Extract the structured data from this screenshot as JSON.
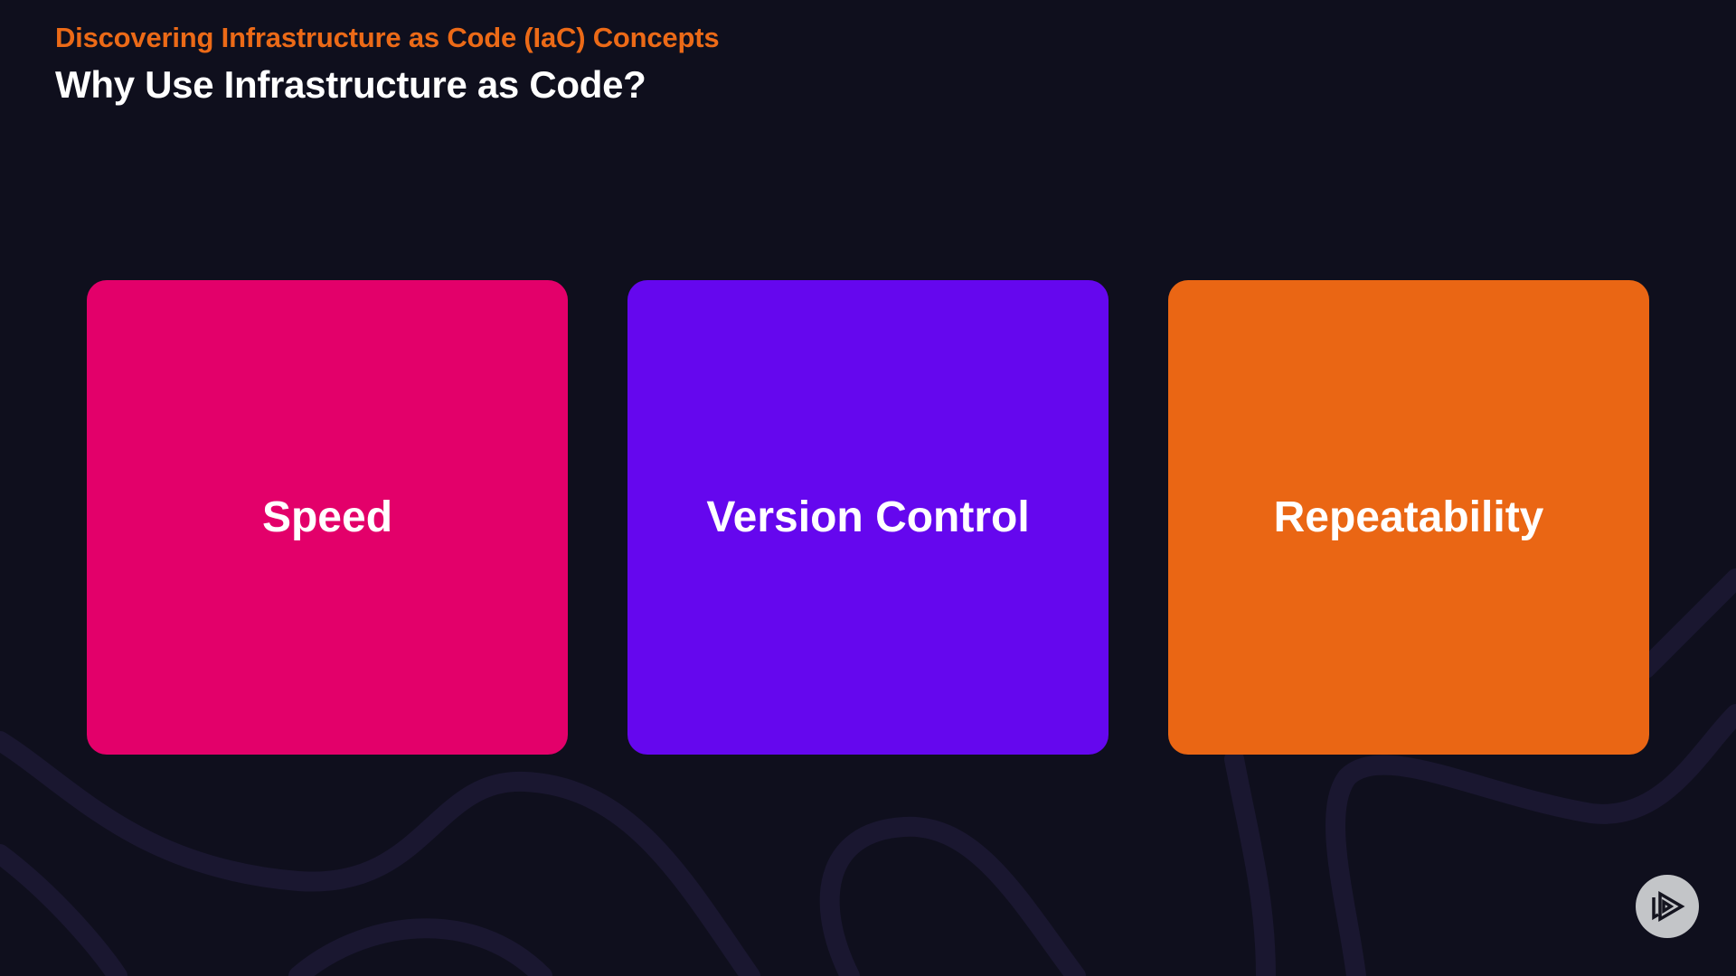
{
  "slide": {
    "subtitle": "Discovering Infrastructure as Code (IaC) Concepts",
    "title": "Why Use Infrastructure as Code?"
  },
  "cards": [
    {
      "label": "Speed",
      "color": "#e3006a"
    },
    {
      "label": "Version Control",
      "color": "#6507ee"
    },
    {
      "label": "Repeatability",
      "color": "#ea6614"
    }
  ],
  "logo": {
    "icon": "pluralsight-play-icon"
  }
}
